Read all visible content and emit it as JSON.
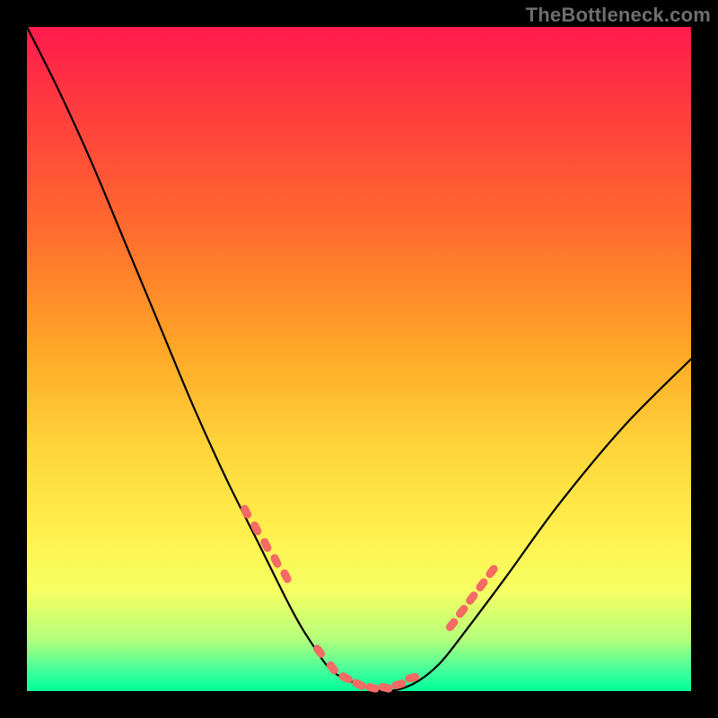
{
  "watermark": "TheBottleneck.com",
  "colors": {
    "background": "#000000",
    "gradient_top": "#ff1a4d",
    "gradient_bottom": "#00ff99",
    "curve": "#000000",
    "marker": "#f46a64"
  },
  "chart_data": {
    "type": "line",
    "title": "",
    "xlabel": "",
    "ylabel": "",
    "xlim": [
      0,
      100
    ],
    "ylim": [
      0,
      100
    ],
    "series": [
      {
        "name": "bottleneck-curve",
        "x": [
          0,
          5,
          10,
          15,
          20,
          25,
          30,
          35,
          40,
          43,
          46,
          50,
          54,
          58,
          62,
          66,
          72,
          80,
          90,
          100
        ],
        "y": [
          100,
          90,
          79,
          67,
          55,
          43,
          32,
          22,
          12,
          7,
          3,
          1,
          0,
          1,
          4,
          9,
          17,
          28,
          40,
          50
        ]
      }
    ],
    "markers": {
      "name": "highlighted-points",
      "x": [
        33,
        34.5,
        36,
        37.5,
        39,
        44,
        46,
        48,
        50,
        52,
        54,
        56,
        58,
        64,
        65.5,
        67,
        68.5,
        70
      ],
      "y": [
        27,
        24.5,
        22,
        19.6,
        17.3,
        6,
        3.5,
        2,
        1,
        0.5,
        0.5,
        1,
        2,
        10,
        12,
        14,
        16,
        18
      ]
    }
  }
}
